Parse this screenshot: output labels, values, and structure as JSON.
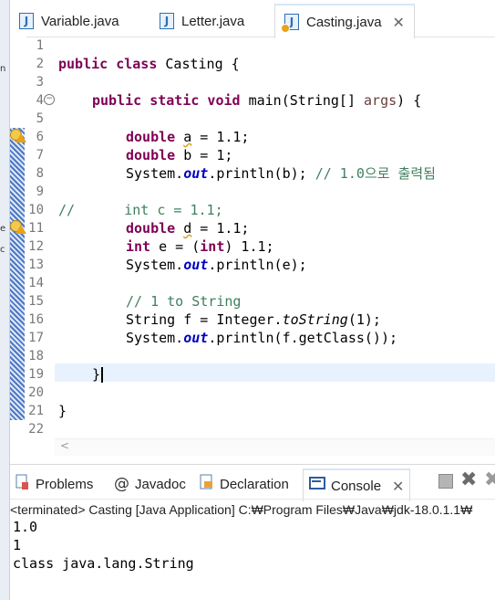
{
  "editor_tabs": [
    {
      "label": "Variable.java",
      "icon": "java-file-icon"
    },
    {
      "label": "Letter.java",
      "icon": "java-file-icon"
    },
    {
      "label": "Casting.java",
      "icon": "java-file-warning-icon",
      "close": "✕"
    }
  ],
  "line_numbers": [
    "1",
    "2",
    "3",
    "4",
    "5",
    "6",
    "7",
    "8",
    "9",
    "10",
    "11",
    "12",
    "13",
    "14",
    "15",
    "16",
    "17",
    "18",
    "19",
    "20",
    "21",
    "22"
  ],
  "code": {
    "l2_kw": "public class",
    "l2_rest": " Casting {",
    "l4_kw": "public static void",
    "l4_main": " main(String[] ",
    "l4_args": "args",
    "l4_end": ") {",
    "l6_kw": "double",
    "l6_var": "a",
    "l6_rest": " = 1.1;",
    "l7_kw": "double",
    "l7_var": "b",
    "l7_rest": " = 1;",
    "l8_a": "System.",
    "l8_out": "out",
    "l8_b": ".println(b); ",
    "l8_comment": "// 1.0으로 출력됨",
    "l10_comment": "//      int c = 1.1;",
    "l11_kw": "double",
    "l11_var": "d",
    "l11_rest": " = 1.1;",
    "l12_kw": "int",
    "l12_a": " e = (",
    "l12_kw2": "int",
    "l12_b": ") 1.1;",
    "l13_a": "System.",
    "l13_out": "out",
    "l13_b": ".println(e);",
    "l15_comment": "// 1 to String",
    "l16_a": "String f = Integer.",
    "l16_m": "toString",
    "l16_b": "(1);",
    "l17_a": "System.",
    "l17_out": "out",
    "l17_b": ".println(f.getClass());",
    "l19": "}",
    "l21": "}"
  },
  "hscroll_arrow": "<",
  "bottom_tabs": [
    {
      "label": "Problems",
      "icon": "problems-icon"
    },
    {
      "label": "Javadoc",
      "icon": "at-icon"
    },
    {
      "label": "Declaration",
      "icon": "declaration-icon"
    },
    {
      "label": "Console",
      "icon": "console-icon",
      "close": "✕"
    }
  ],
  "toolbar_icons": [
    "stop-icon",
    "remove-launch-icon",
    "remove-all-icon"
  ],
  "console": {
    "status": "<terminated> Casting [Java Application] C:₩Program Files₩Java₩jdk-18.0.1.1₩",
    "output": [
      "1.0",
      "1",
      "class java.lang.String"
    ]
  },
  "colors": {
    "keyword": "#7f0055",
    "comment": "#3f7f5f",
    "field": "#0000c0",
    "current_line": "#e8f2fe"
  }
}
